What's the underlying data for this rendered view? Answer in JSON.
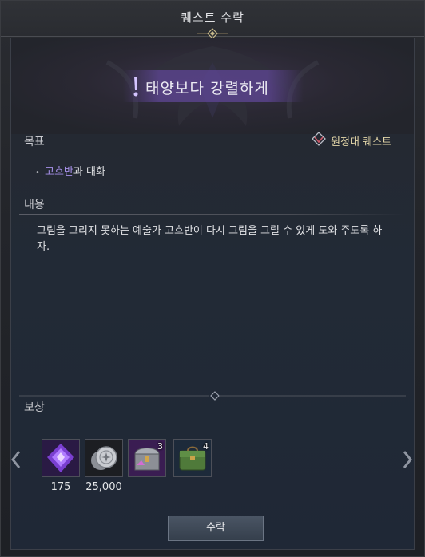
{
  "window": {
    "title": "퀘스트 수락"
  },
  "quest": {
    "name": "태양보다 강렬하게",
    "type_label": "원정대 퀘스트"
  },
  "sections": {
    "objective_label": "목표",
    "content_label": "내용",
    "reward_label": "보상"
  },
  "objective": {
    "target": "고흐반",
    "text": "과 대화"
  },
  "description": "그림을 그리지 못하는 예술가 고흐반이 다시 그림을 그릴 수 있게 도와 주도록 하자.",
  "rewards": [
    {
      "icon": "purple-gem-icon",
      "quantity": "175",
      "badge": ""
    },
    {
      "icon": "silver-coin-icon",
      "quantity": "25,000",
      "badge": ""
    },
    {
      "icon": "treasure-chest-icon",
      "quantity": "",
      "badge": "3"
    },
    {
      "icon": "green-bag-icon",
      "quantity": "",
      "badge": "4"
    }
  ],
  "buttons": {
    "accept": "수락"
  },
  "colors": {
    "accent_purple": "#a690e8",
    "expedition_gold": "#e3d6a8",
    "title_banner": "#5f4696"
  }
}
